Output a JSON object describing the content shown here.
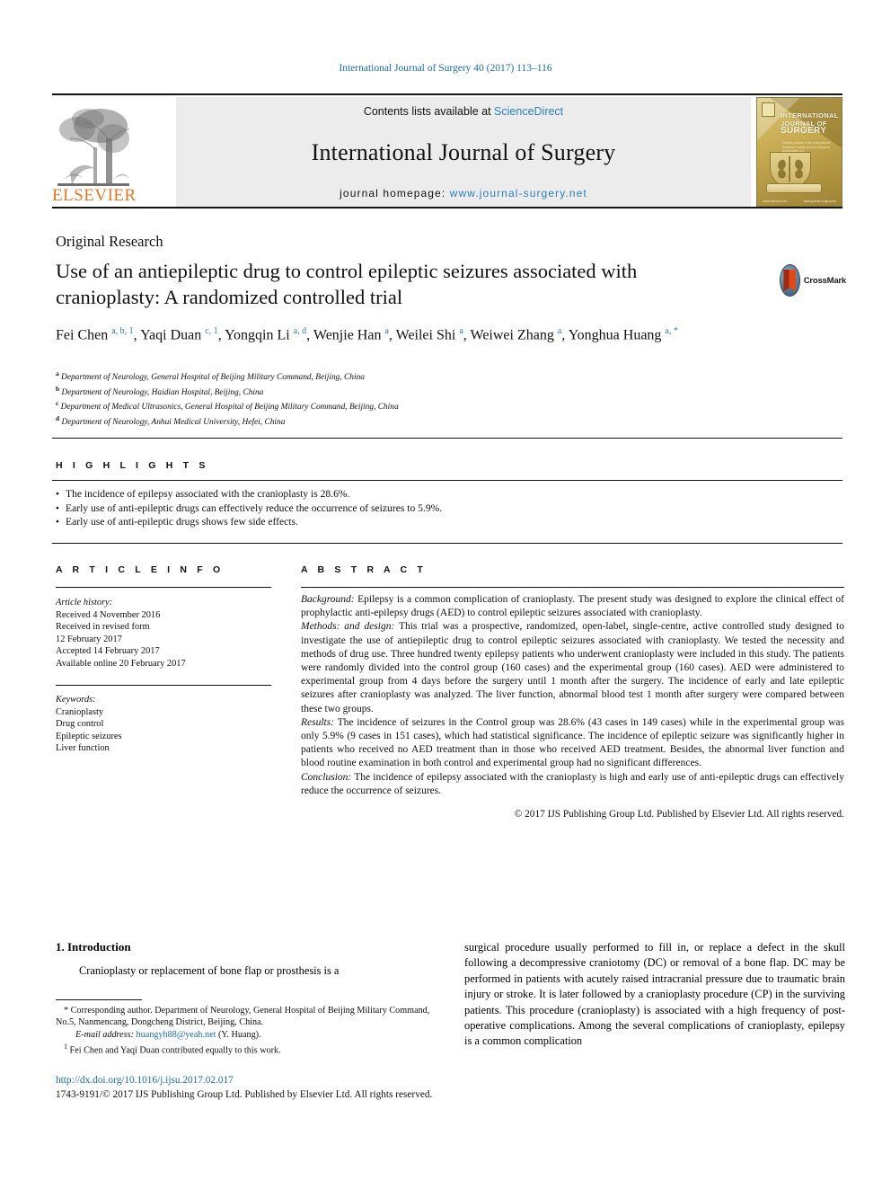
{
  "running_head": "International Journal of Surgery 40 (2017) 113–116",
  "banner": {
    "contents_prefix": "Contents lists available at ",
    "sciencedirect": "ScienceDirect",
    "journal_name": "International Journal of Surgery",
    "homepage_prefix": "journal homepage: ",
    "homepage_url": "www.journal-surgery.net",
    "publisher_logo_text": "ELSEVIER",
    "publisher_logo_icon": "elsevier-tree-icon",
    "cover": {
      "line1": "INTERNATIONAL",
      "line2": "JOURNAL OF",
      "line3": "SURGERY",
      "subtitle": "Official journal of the International Surgical Society and the Surgical Associates Ltd",
      "foot_left": "www.elsevier.com",
      "foot_right": "www.journal-surgery.net"
    },
    "accent_link_color": "#2a7fc0"
  },
  "article": {
    "type": "Original Research",
    "title": "Use of an antiepileptic drug to control epileptic seizures associated with cranioplasty: A randomized controlled trial",
    "crossmark_label": "CrossMark",
    "authors_html": "Fei Chen <sup>a, b, 1</sup>, Yaqi Duan <sup>c, 1</sup>, Yongqin Li <sup>a, d</sup>, Wenjie Han <sup>a</sup>, Weilei Shi <sup>a</sup>, Weiwei Zhang <sup>a</sup>, Yonghua Huang <sup>a, *</sup>",
    "affiliations": [
      {
        "mark": "a",
        "text": "Department of Neurology, General Hospital of Beijing Military Command, Beijing, China"
      },
      {
        "mark": "b",
        "text": "Department of Neurology, Haidian Hospital, Beijing, China"
      },
      {
        "mark": "c",
        "text": "Department of Medical Ultrasonics, General Hospital of Beijing Military Command, Beijing, China"
      },
      {
        "mark": "d",
        "text": "Department of Neurology, Anhui Medical University, Hefei, China"
      }
    ]
  },
  "highlights": {
    "label": "H I G H L I G H T S",
    "items": [
      "The incidence of epilepsy associated with the cranioplasty is 28.6%.",
      "Early use of anti-epileptic drugs can effectively reduce the occurrence of seizures to 5.9%.",
      "Early use of anti-epileptic drugs shows few side effects."
    ]
  },
  "article_info": {
    "label": "A R T I C L E   I N F O",
    "history_heading": "Article history:",
    "history_lines": [
      "Received 4 November 2016",
      "Received in revised form",
      "12 February 2017",
      "Accepted 14 February 2017",
      "Available online 20 February 2017"
    ],
    "keywords_heading": "Keywords:",
    "keywords": [
      "Cranioplasty",
      "Drug control",
      "Epileptic seizures",
      "Liver function"
    ]
  },
  "abstract": {
    "label": "A B S T R A C T",
    "sections": [
      {
        "heading": "Background:",
        "text": " Epilepsy is a common complication of cranioplasty. The present study was designed to explore the clinical effect of prophylactic anti-epilepsy drugs (AED) to control epileptic seizures associated with cranioplasty."
      },
      {
        "heading": "Methods: and design:",
        "text": " This trial was a prospective, randomized, open-label, single-centre, active controlled study designed to investigate the use of antiepileptic drug to control epileptic seizures associated with cranioplasty. We tested the necessity and methods of drug use. Three hundred twenty epilepsy patients who underwent cranioplasty were included in this study. The patients were randomly divided into the control group (160 cases) and the experimental group (160 cases). AED were administered to experimental group from 4 days before the surgery until 1 month after the surgery. The incidence of early and late epileptic seizures after cranioplasty was analyzed. The liver function, abnormal blood test 1 month after surgery were compared between these two groups."
      },
      {
        "heading": "Results:",
        "text": " The incidence of seizures in the Control group was 28.6% (43 cases in 149 cases) while in the experimental group was only 5.9% (9 cases in 151 cases), which had statistical significance. The incidence of epileptic seizure was significantly higher in patients who received no AED treatment than in those who received AED treatment. Besides, the abnormal liver function and blood routine examination in both control and experimental group had no significant differences."
      },
      {
        "heading": "Conclusion:",
        "text": " The incidence of epilepsy associated with the cranioplasty is high and early use of anti-epileptic drugs can effectively reduce the occurrence of seizures."
      }
    ],
    "copyright": "© 2017 IJS Publishing Group Ltd. Published by Elsevier Ltd. All rights reserved."
  },
  "body": {
    "section_number_title": "1.  Introduction",
    "left_paragraph": "Cranioplasty or replacement of bone flap or prosthesis is a",
    "right_paragraph": "surgical procedure usually performed to fill in, or replace a defect in the skull following a decompressive craniotomy (DC) or removal of a bone flap. DC may be performed in patients with acutely raised intracranial pressure due to traumatic brain injury or stroke. It is later followed by a cranioplasty procedure (CP) in the surviving patients. This procedure (cranioplasty) is associated with a high frequency of post-operative complications. Among the several complications of cranioplasty, epilepsy is a common complication"
  },
  "footnotes": {
    "corresponding": "Corresponding author. Department of Neurology, General Hospital of Beijing Military Command, No.5, Nanmencang, Dongcheng District, Beijing, China.",
    "email_label": "E-mail address:",
    "email": "huangyh88@yeah.net",
    "email_suffix": " (Y. Huang).",
    "equal_contribution": "Fei Chen and Yaqi Duan contributed equally to this work.",
    "doi": "http://dx.doi.org/10.1016/j.ijsu.2017.02.017",
    "issn_line": "1743-9191/© 2017 IJS Publishing Group Ltd. Published by Elsevier Ltd. All rights reserved."
  }
}
